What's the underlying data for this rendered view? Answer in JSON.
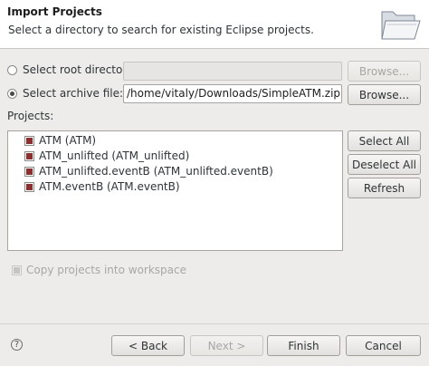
{
  "header": {
    "title": "Import Projects",
    "description": "Select a directory to search for existing Eclipse projects."
  },
  "root_directory": {
    "label": "Select root directory:",
    "value": "",
    "browse_label": "Browse...",
    "selected": false
  },
  "archive_file": {
    "label": "Select archive file:",
    "value": "/home/vitaly/Downloads/SimpleATM.zip",
    "browse_label": "Browse...",
    "selected": true
  },
  "projects": {
    "label": "Projects:",
    "items": [
      {
        "label": "ATM (ATM)",
        "checked": true
      },
      {
        "label": "ATM_unlifted (ATM_unlifted)",
        "checked": true
      },
      {
        "label": "ATM_unlifted.eventB (ATM_unlifted.eventB)",
        "checked": true
      },
      {
        "label": "ATM.eventB (ATM.eventB)",
        "checked": true
      }
    ],
    "select_all_label": "Select All",
    "deselect_all_label": "Deselect All",
    "refresh_label": "Refresh"
  },
  "copy_projects": {
    "label": "Copy projects into workspace",
    "checked": true,
    "enabled": false
  },
  "footer": {
    "help_glyph": "?",
    "back_label": "< Back",
    "next_label": "Next >",
    "finish_label": "Finish",
    "cancel_label": "Cancel"
  },
  "icons": {
    "header": "folder-open-icon",
    "help": "help-icon"
  }
}
